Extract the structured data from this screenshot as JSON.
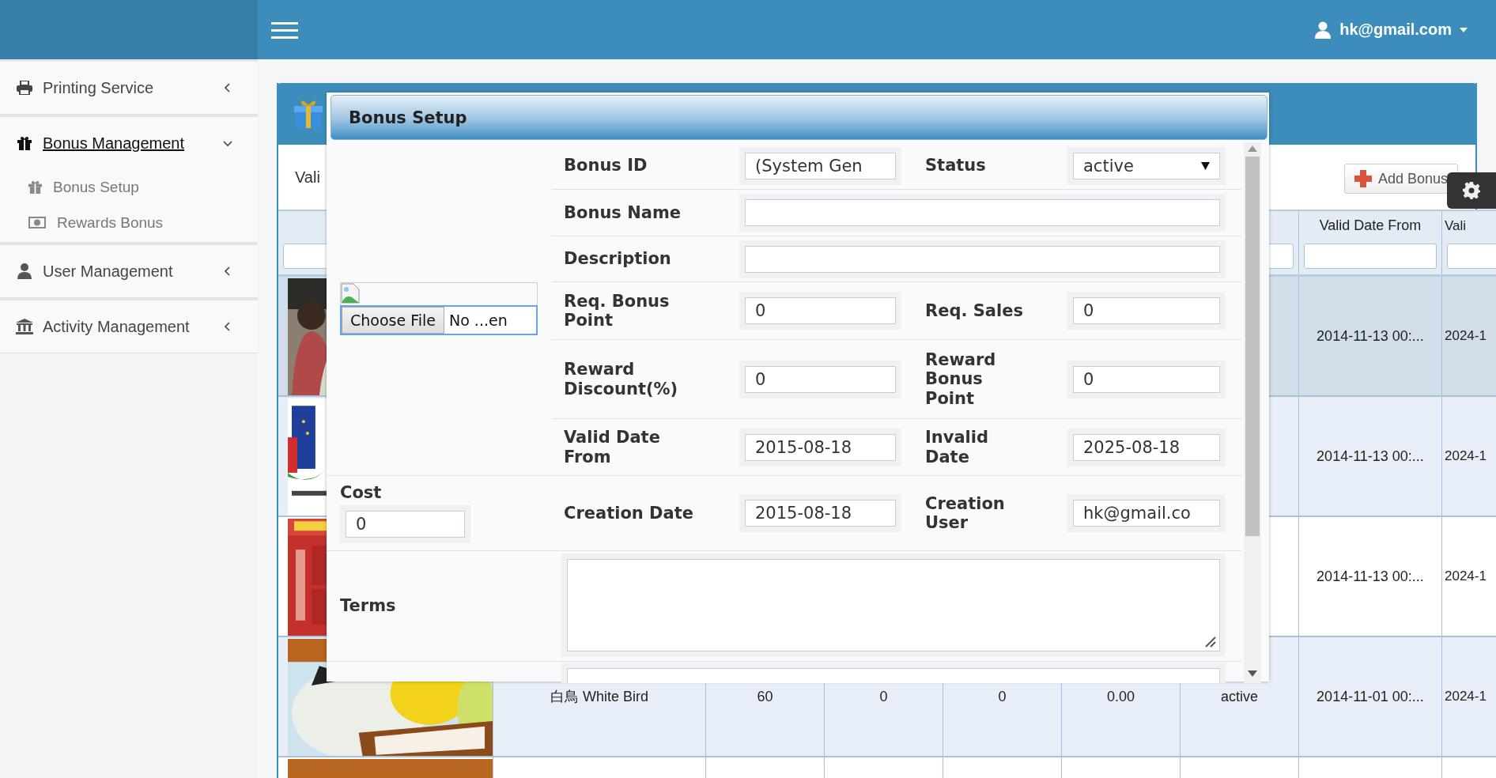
{
  "header": {
    "user_email": "hk@gmail.com"
  },
  "sidebar": {
    "items": [
      {
        "label": "Printing Service",
        "expanded": false,
        "selected": false
      },
      {
        "label": "Bonus Management",
        "expanded": true,
        "selected": true,
        "children": [
          {
            "label": "Bonus Setup"
          },
          {
            "label": "Rewards Bonus"
          }
        ]
      },
      {
        "label": "User Management",
        "expanded": false,
        "selected": false
      },
      {
        "label": "Activity Management",
        "expanded": false,
        "selected": false
      }
    ]
  },
  "panel": {
    "toolbar_text": "Vali",
    "add_button": "Add Bonus"
  },
  "table": {
    "columns": [
      {
        "label": "Valid Date From"
      },
      {
        "label": "Vali"
      }
    ],
    "rows": [
      {
        "selected": true,
        "cells": [
          null,
          null,
          null,
          null,
          null,
          null,
          "2014-11-13 00:...",
          "2024-1"
        ]
      },
      {
        "selected": false,
        "cells": [
          null,
          null,
          null,
          null,
          null,
          null,
          "2014-11-13 00:...",
          "2024-1"
        ]
      },
      {
        "selected": false,
        "cells": [
          null,
          null,
          null,
          null,
          null,
          null,
          "2014-11-13 00:...",
          "2024-1"
        ]
      },
      {
        "selected": false,
        "cells": [
          "白鳥 White Bird",
          "60",
          "0",
          "0",
          "0.00",
          "active",
          "2014-11-01 00:...",
          "2024-1"
        ]
      },
      {
        "selected": false
      }
    ]
  },
  "dialog": {
    "title": "Bonus Setup",
    "upload": {
      "button": "Choose File",
      "file_name": "No ...en"
    },
    "rows": [
      {
        "fields": [
          {
            "label": "Bonus ID",
            "kind": "text",
            "value": "(System Gen"
          },
          {
            "label": "Status",
            "kind": "select",
            "value": "active"
          }
        ]
      },
      {
        "fields": [
          {
            "label": "Bonus Name",
            "kind": "text"
          }
        ]
      },
      {
        "fields": [
          {
            "label": "Description",
            "kind": "text"
          }
        ]
      },
      {
        "fields": [
          {
            "label": "Req. Bonus Point",
            "kind": "text",
            "value": "0"
          },
          {
            "label": "Req. Sales",
            "kind": "text",
            "value": "0"
          }
        ]
      },
      {
        "fields": [
          {
            "label": "Reward Discount(%)",
            "kind": "text",
            "value": "0"
          },
          {
            "label": "Reward Bonus Point",
            "kind": "text",
            "value": "0"
          }
        ]
      },
      {
        "fields": [
          {
            "label": "Valid Date From",
            "kind": "text",
            "value": "2015-08-18"
          },
          {
            "label": "Invalid Date",
            "kind": "text",
            "value": "2025-08-18"
          }
        ]
      }
    ],
    "cost": {
      "label": "Cost",
      "value": "0"
    },
    "creation": [
      {
        "label": "Creation Date",
        "value": "2015-08-18"
      },
      {
        "label": "Creation User",
        "value": "hk@gmail.co"
      }
    ],
    "terms": {
      "label": "Terms"
    }
  }
}
